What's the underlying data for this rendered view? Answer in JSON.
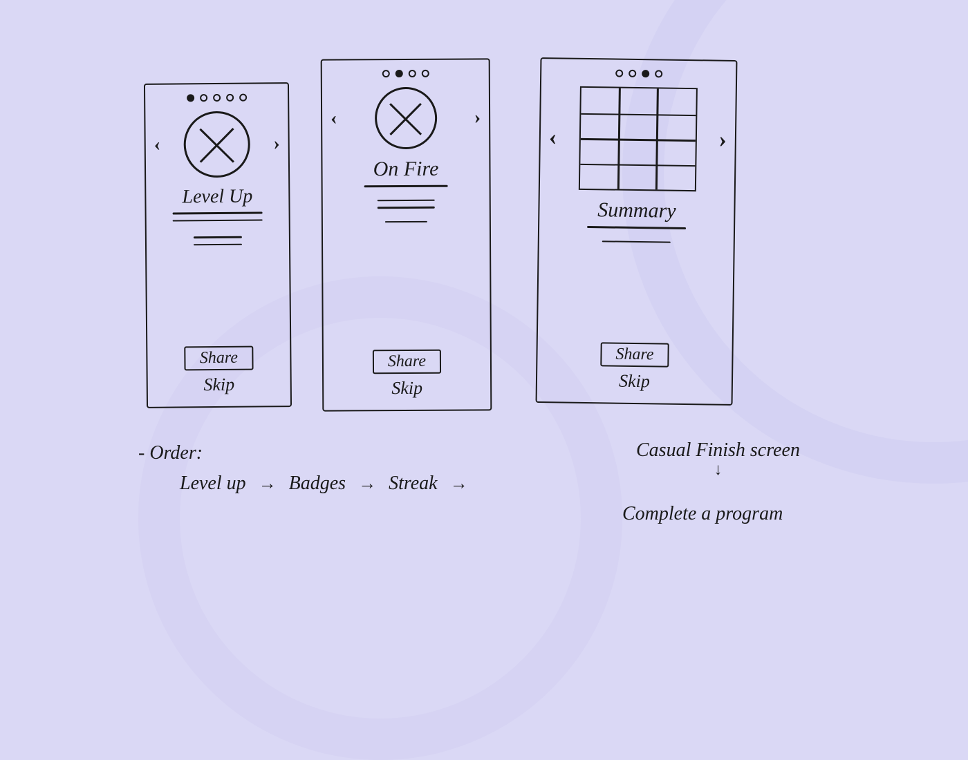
{
  "screens": [
    {
      "title": "Level Up",
      "share": "Share",
      "skip": "Skip",
      "page_dots": 5,
      "active_dot": 0,
      "hero": "circle-x"
    },
    {
      "title": "On Fire",
      "share": "Share",
      "skip": "Skip",
      "page_dots": 4,
      "active_dot": 1,
      "hero": "circle-x"
    },
    {
      "title": "Summary",
      "share": "Share",
      "skip": "Skip",
      "page_dots": 4,
      "active_dot": 2,
      "hero": "grid"
    }
  ],
  "notes": {
    "label": "- Order:",
    "flow": [
      "Level up",
      "Badges",
      "Streak",
      "Casual Finish screen",
      "Complete a program"
    ]
  }
}
